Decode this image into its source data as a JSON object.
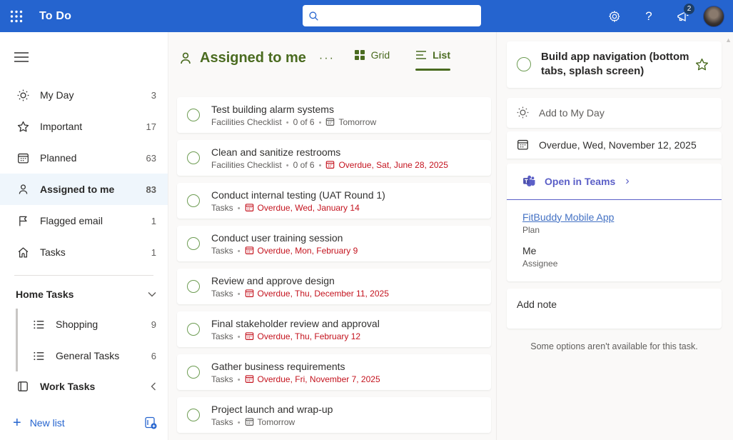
{
  "colors": {
    "topbar_blue": "#2564cf",
    "theme_green": "#4a6b20",
    "checkbox_green": "#6d9c52",
    "overdue_red": "#c4131e",
    "teams_purple": "#5b5fc7",
    "link_blue": "#4472c4",
    "selected_bg": "#eff6fc"
  },
  "topbar": {
    "app_title": "To Do",
    "search_placeholder": "",
    "announcements_badge": "2",
    "help_glyph": "?",
    "icons": [
      "app-launcher",
      "search",
      "settings-gear",
      "help",
      "megaphone",
      "avatar"
    ]
  },
  "sidebar": {
    "items": [
      {
        "label": "My Day",
        "count": "3",
        "icon": "sun-icon"
      },
      {
        "label": "Important",
        "count": "17",
        "icon": "star-icon"
      },
      {
        "label": "Planned",
        "count": "63",
        "icon": "calendar-icon"
      },
      {
        "label": "Assigned to me",
        "count": "83",
        "icon": "person-icon",
        "selected": true
      },
      {
        "label": "Flagged email",
        "count": "1",
        "icon": "flag-icon"
      },
      {
        "label": "Tasks",
        "count": "1",
        "icon": "home-icon"
      }
    ],
    "groups": [
      {
        "label": "Home Tasks",
        "state": "expanded",
        "lists": [
          {
            "label": "Shopping",
            "count": "9",
            "icon": "list-icon"
          },
          {
            "label": "General Tasks",
            "count": "6",
            "icon": "list-icon"
          }
        ]
      },
      {
        "label": "Work Tasks",
        "state": "collapsed",
        "lists": []
      }
    ],
    "new_list_label": "New list",
    "plus_glyph": "+"
  },
  "main": {
    "title": "Assigned to me",
    "more_glyph": "···",
    "view_toggle": {
      "grid_label": "Grid",
      "list_label": "List",
      "active": "List"
    },
    "tasks": [
      {
        "title": "Test building alarm systems",
        "list": "Facilities Checklist",
        "progress": "0 of 6",
        "due": "Tomorrow",
        "overdue": false
      },
      {
        "title": "Clean and sanitize restrooms",
        "list": "Facilities Checklist",
        "progress": "0 of 6",
        "due": "Overdue, Sat, June 28, 2025",
        "overdue": true
      },
      {
        "title": "Conduct internal testing (UAT Round 1)",
        "list": "Tasks",
        "progress": null,
        "due": "Overdue, Wed, January 14",
        "overdue": true
      },
      {
        "title": "Conduct user training session",
        "list": "Tasks",
        "progress": null,
        "due": "Overdue, Mon, February 9",
        "overdue": true
      },
      {
        "title": "Review and approve design",
        "list": "Tasks",
        "progress": null,
        "due": "Overdue, Thu, December 11, 2025",
        "overdue": true
      },
      {
        "title": "Final stakeholder review and approval",
        "list": "Tasks",
        "progress": null,
        "due": "Overdue, Thu, February 12",
        "overdue": true
      },
      {
        "title": "Gather business requirements",
        "list": "Tasks",
        "progress": null,
        "due": "Overdue, Fri, November 7, 2025",
        "overdue": true
      },
      {
        "title": "Project launch and wrap-up",
        "list": "Tasks",
        "progress": null,
        "due": "Tomorrow",
        "overdue": false
      }
    ]
  },
  "detail": {
    "title": "Build app navigation (bottom tabs, splash screen)",
    "my_day_label": "Add to My Day",
    "due_text": "Overdue, Wed, November 12, 2025",
    "teams_label": "Open in Teams",
    "teams_chevron": "›",
    "plan_link": "FitBuddy Mobile App",
    "plan_sublabel": "Plan",
    "assignee_value": "Me",
    "assignee_sublabel": "Assignee",
    "note_placeholder": "Add note",
    "footer_note": "Some options aren't available for this task."
  }
}
